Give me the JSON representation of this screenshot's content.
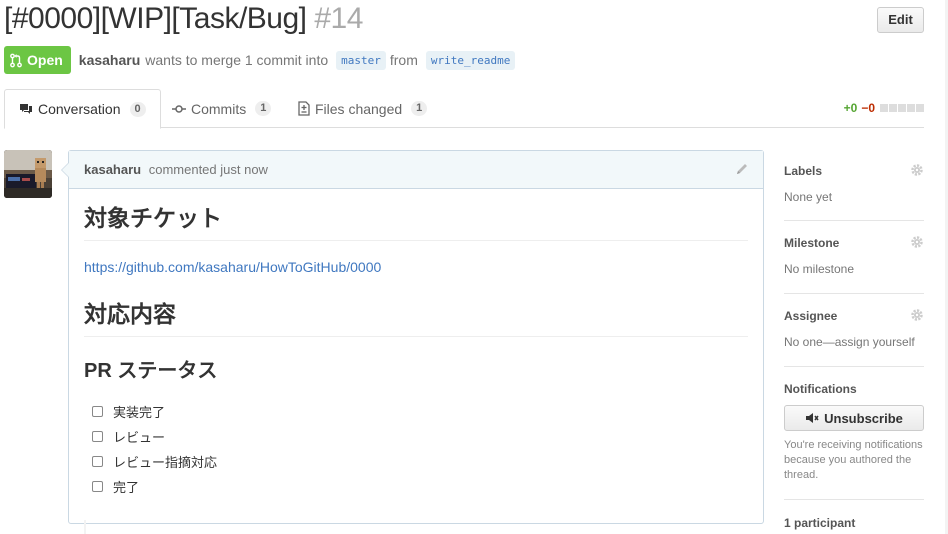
{
  "pr": {
    "title": "[#0000][WIP][Task/Bug]",
    "number": "#14",
    "edit_label": "Edit",
    "state_label": "Open",
    "author": "kasaharu",
    "merge_text": "wants to merge 1 commit into",
    "base_branch": "master",
    "from_text": "from",
    "head_branch": "write_readme"
  },
  "tabs": [
    {
      "label": "Conversation",
      "count": "0"
    },
    {
      "label": "Commits",
      "count": "1"
    },
    {
      "label": "Files changed",
      "count": "1"
    }
  ],
  "diffstat": {
    "additions": "+0",
    "deletions": "−0"
  },
  "comment": {
    "author": "kasaharu",
    "action": "commented just now",
    "heading1": "対象チケット",
    "link": "https://github.com/kasaharu/HowToGitHub/0000",
    "heading2": "対応内容",
    "heading3": "PR ステータス",
    "tasks": [
      "実装完了",
      "レビュー",
      "レビュー指摘対応",
      "完了"
    ]
  },
  "sidebar": {
    "labels_heading": "Labels",
    "labels_value": "None yet",
    "milestone_heading": "Milestone",
    "milestone_value": "No milestone",
    "assignee_heading": "Assignee",
    "assignee_value": "No one—assign yourself",
    "notifications_heading": "Notifications",
    "unsubscribe_label": "Unsubscribe",
    "notifications_note": "You're receiving notifications because you authored the thread.",
    "participants": "1 participant"
  },
  "colors": {
    "open_state": "#6cc644",
    "link": "#4078c0",
    "addition": "#55a532",
    "deletion": "#bd2c00"
  }
}
